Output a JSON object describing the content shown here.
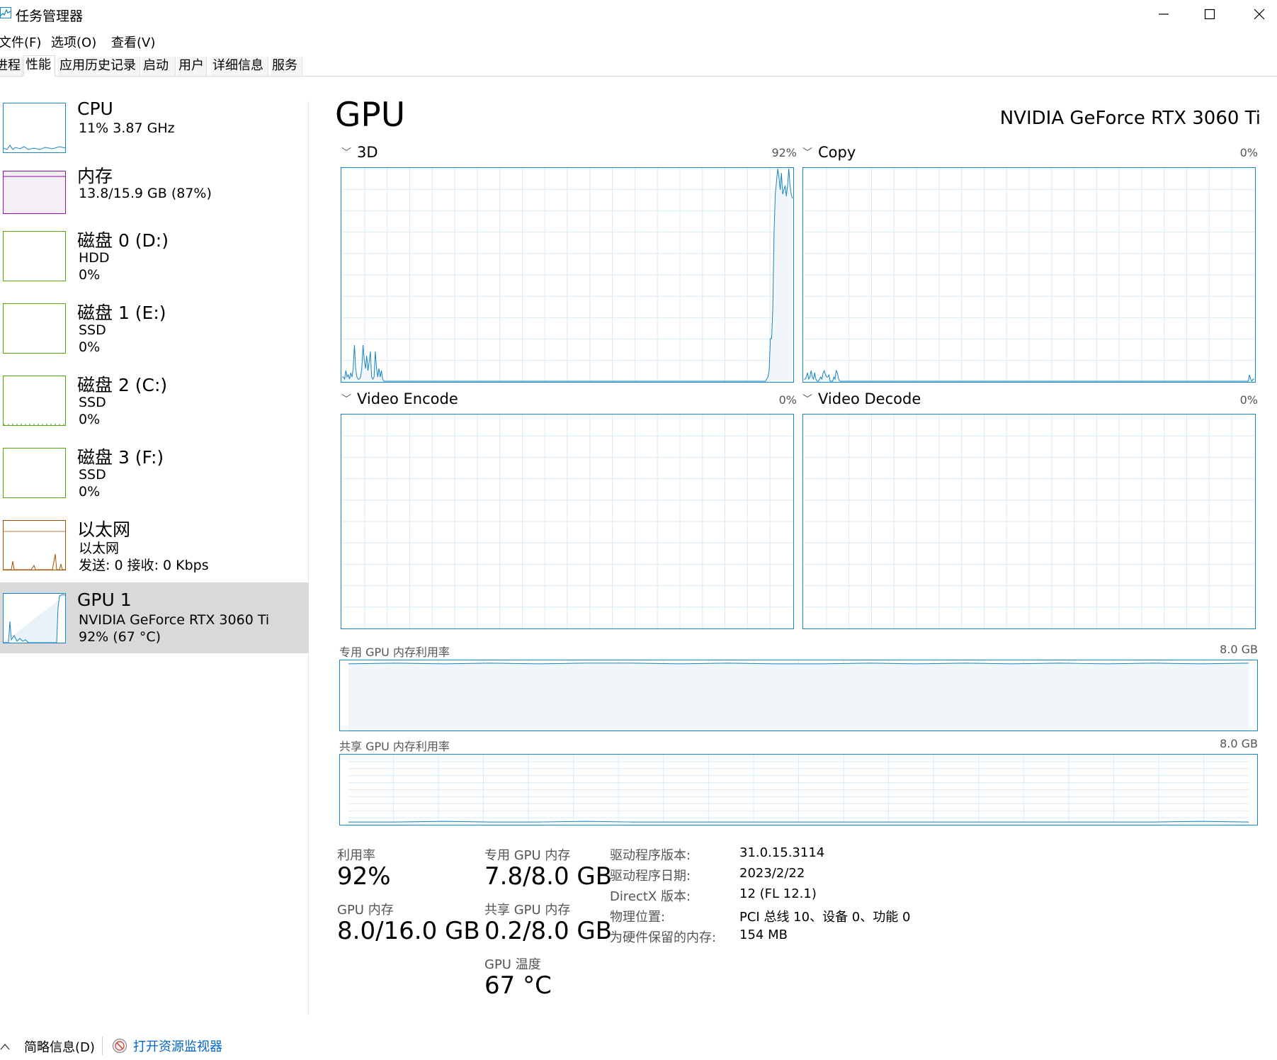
{
  "window": {
    "title": "任务管理器",
    "controls": [
      "minimize",
      "maximize",
      "close"
    ]
  },
  "menu": [
    "文件(F)",
    "选项(O)",
    "查看(V)"
  ],
  "tabs": [
    "进程",
    "性能",
    "应用历史记录",
    "启动",
    "用户",
    "详细信息",
    "服务"
  ],
  "active_tab": "性能",
  "sidebar": [
    {
      "title": "CPU",
      "line1": "11%  3.87 GHz",
      "line2": "",
      "color": "#1784c4"
    },
    {
      "title": "内存",
      "line1": "13.8/15.9 GB (87%)",
      "line2": "",
      "color": "#8b12ae"
    },
    {
      "title": "磁盘 0 (D:)",
      "line1": "HDD",
      "line2": "0%",
      "color": "#4da60c"
    },
    {
      "title": "磁盘 1 (E:)",
      "line1": "SSD",
      "line2": "0%",
      "color": "#4da60c"
    },
    {
      "title": "磁盘 2 (C:)",
      "line1": "SSD",
      "line2": "0%",
      "color": "#4da60c"
    },
    {
      "title": "磁盘 3 (F:)",
      "line1": "SSD",
      "line2": "0%",
      "color": "#4da60c"
    },
    {
      "title": "以太网",
      "line1": "以太网",
      "line2": "发送: 0 接收: 0 Kbps",
      "color": "#a74f01"
    },
    {
      "title": "GPU 1",
      "line1": "NVIDIA GeForce RTX 3060 Ti",
      "line2": "92%  (67 °C)",
      "color": "#1784c4"
    }
  ],
  "selected_index": 7,
  "gpu": {
    "heading": "GPU",
    "model": "NVIDIA GeForce RTX 3060 Ti",
    "engines": [
      {
        "name": "3D",
        "percent": "92%"
      },
      {
        "name": "Copy",
        "percent": "0%"
      },
      {
        "name": "Video Encode",
        "percent": "0%"
      },
      {
        "name": "Video Decode",
        "percent": "0%"
      }
    ],
    "dedicated_mem_graph": {
      "label": "专用 GPU 内存利用率",
      "max": "8.0 GB"
    },
    "shared_mem_graph": {
      "label": "共享 GPU 内存利用率",
      "max": "8.0 GB"
    }
  },
  "stats": {
    "utilization_label": "利用率",
    "utilization": "92%",
    "gpu_mem_label": "GPU 内存",
    "gpu_mem": "8.0/16.0 GB",
    "dedicated_label": "专用 GPU 内存",
    "dedicated": "7.8/8.0 GB",
    "shared_label": "共享 GPU 内存",
    "shared": "0.2/8.0 GB",
    "temp_label": "GPU 温度",
    "temp": "67 °C"
  },
  "info": [
    {
      "key": "驱动程序版本:",
      "value": "31.0.15.3114"
    },
    {
      "key": "驱动程序日期:",
      "value": "2023/2/22"
    },
    {
      "key": "DirectX 版本:",
      "value": "12 (FL 12.1)"
    },
    {
      "key": "物理位置:",
      "value": "PCI 总线 10、设备 0、功能 0"
    },
    {
      "key": "为硬件保留的内存:",
      "value": "154 MB"
    }
  ],
  "footer": {
    "summary": "简略信息(D)",
    "resource_monitor": "打开资源监视器"
  },
  "series": {
    "3d": [
      2,
      2,
      1,
      5,
      2,
      3,
      1,
      4,
      2,
      6,
      17,
      6,
      2,
      1,
      1,
      2,
      6,
      17,
      10,
      6,
      12,
      5,
      9,
      14,
      2,
      1,
      2,
      14,
      6,
      2,
      6,
      2,
      5,
      1,
      0,
      0,
      0,
      0,
      0,
      0,
      0,
      0,
      0,
      0,
      0,
      0,
      0,
      0,
      0,
      0,
      0,
      0,
      0,
      0,
      0,
      0,
      0,
      0,
      0,
      0,
      0,
      0,
      0,
      0,
      0,
      0,
      0,
      0,
      0,
      0,
      0,
      0,
      0,
      0,
      0,
      0,
      0,
      0,
      0,
      0,
      0,
      0,
      0,
      0,
      0,
      0,
      0,
      0,
      0,
      0,
      0,
      0,
      0,
      0,
      0,
      0,
      0,
      0,
      0,
      0,
      0,
      0,
      0,
      0,
      0,
      0,
      0,
      0,
      0,
      0,
      0,
      0,
      0,
      0,
      0,
      0,
      0,
      0,
      0,
      0,
      0,
      0,
      0,
      0,
      0,
      0,
      0,
      0,
      0,
      0,
      0,
      0,
      0,
      0,
      0,
      0,
      0,
      0,
      0,
      0,
      0,
      0,
      0,
      0,
      0,
      0,
      0,
      0,
      0,
      0,
      0,
      0,
      0,
      0,
      0,
      0,
      0,
      0,
      0,
      0,
      0,
      0,
      0,
      0,
      0,
      0,
      0,
      0,
      0,
      0,
      0,
      0,
      0,
      0,
      0,
      0,
      0,
      0,
      0,
      0,
      0,
      0,
      0,
      0,
      0,
      0,
      0,
      0,
      0,
      0,
      0,
      0,
      0,
      0,
      0,
      0,
      0,
      0,
      0,
      0,
      0,
      0,
      0,
      0,
      0,
      0,
      0,
      0,
      0,
      0,
      0,
      0,
      0,
      0,
      0,
      0,
      0,
      0,
      0,
      0,
      0,
      0,
      0,
      0,
      0,
      0,
      0,
      0,
      0,
      0,
      0,
      0,
      0,
      0,
      0,
      0,
      0,
      0,
      0,
      0,
      0,
      0,
      0,
      0,
      0,
      0,
      0,
      0,
      0,
      0,
      0,
      0,
      0,
      0,
      0,
      0,
      0,
      0,
      0,
      0,
      0,
      0,
      0,
      0,
      0,
      0,
      0,
      0,
      0,
      0,
      0,
      0,
      0,
      0,
      0,
      0,
      0,
      0,
      0,
      0,
      0,
      0,
      0,
      0,
      0,
      0,
      0,
      0,
      0,
      0,
      0,
      0,
      0,
      0,
      0,
      0,
      0,
      0,
      0,
      0,
      0,
      0,
      0,
      0,
      0,
      0,
      0,
      0,
      0,
      0,
      0,
      0,
      0,
      0,
      0,
      0,
      0,
      0,
      0,
      0,
      0,
      0,
      0,
      0,
      0,
      0,
      0,
      0,
      0,
      0,
      0,
      0,
      0,
      0,
      0,
      0,
      0,
      0,
      0,
      0,
      0,
      0,
      0,
      0,
      0,
      0,
      1,
      2,
      5,
      20,
      20,
      35,
      70,
      88,
      94,
      100,
      96,
      90,
      98,
      88,
      90,
      92,
      87,
      92,
      100,
      92,
      88,
      86
    ],
    "copy": [
      1,
      1,
      2,
      4,
      1,
      2,
      5,
      2,
      1,
      4,
      1,
      0,
      0,
      1,
      2,
      1,
      4,
      5,
      3,
      2,
      2,
      3,
      0,
      0,
      0,
      2,
      1,
      5,
      4,
      1,
      0,
      0,
      0,
      0,
      0,
      0,
      0,
      0,
      0,
      0,
      0,
      0,
      0,
      0,
      0,
      0,
      0,
      0,
      0,
      0,
      0,
      0,
      0,
      0,
      0,
      0,
      0,
      0,
      0,
      0,
      0,
      0,
      0,
      0,
      0,
      0,
      0,
      0,
      0,
      0,
      0,
      0,
      0,
      0,
      0,
      0,
      0,
      0,
      0,
      0,
      0,
      0,
      0,
      0,
      0,
      0,
      0,
      0,
      0,
      0,
      0,
      0,
      0,
      0,
      0,
      0,
      0,
      0,
      0,
      0,
      0,
      0,
      0,
      0,
      0,
      0,
      0,
      0,
      0,
      0,
      0,
      0,
      0,
      0,
      0,
      0,
      0,
      0,
      0,
      0,
      0,
      0,
      0,
      0,
      0,
      0,
      0,
      0,
      0,
      0,
      0,
      0,
      0,
      0,
      0,
      0,
      0,
      0,
      0,
      0,
      0,
      0,
      0,
      0,
      0,
      0,
      0,
      0,
      0,
      0,
      0,
      0,
      0,
      0,
      0,
      0,
      0,
      0,
      0,
      0,
      0,
      0,
      0,
      0,
      0,
      0,
      0,
      0,
      0,
      0,
      0,
      0,
      0,
      0,
      0,
      0,
      0,
      0,
      0,
      0,
      0,
      0,
      0,
      0,
      0,
      0,
      0,
      0,
      0,
      0,
      0,
      0,
      0,
      0,
      0,
      0,
      0,
      0,
      0,
      0,
      0,
      0,
      0,
      0,
      0,
      0,
      0,
      0,
      0,
      0,
      0,
      0,
      0,
      0,
      0,
      0,
      0,
      0,
      0,
      0,
      0,
      0,
      0,
      0,
      0,
      0,
      0,
      0,
      0,
      0,
      0,
      0,
      0,
      0,
      0,
      0,
      0,
      0,
      0,
      0,
      0,
      0,
      0,
      0,
      0,
      0,
      0,
      0,
      0,
      0,
      0,
      0,
      0,
      0,
      0,
      0,
      0,
      0,
      0,
      0,
      0,
      0,
      0,
      0,
      0,
      0,
      0,
      0,
      0,
      0,
      0,
      0,
      0,
      0,
      0,
      0,
      0,
      0,
      0,
      0,
      0,
      0,
      0,
      0,
      0,
      0,
      0,
      0,
      0,
      0,
      0,
      0,
      0,
      0,
      0,
      0,
      0,
      0,
      0,
      0,
      0,
      0,
      0,
      0,
      0,
      0,
      0,
      0,
      0,
      0,
      0,
      0,
      0,
      0,
      0,
      0,
      0,
      0,
      0,
      0,
      0,
      0,
      0,
      0,
      0,
      0,
      0,
      0,
      0,
      0,
      0,
      0,
      0,
      0,
      0,
      0,
      0,
      0,
      0,
      0,
      0,
      0,
      0,
      0,
      0,
      0,
      0,
      0,
      0,
      0,
      0,
      0,
      0,
      0,
      0,
      0,
      0,
      0,
      0,
      0,
      0,
      0,
      0,
      0,
      0,
      0,
      0,
      0,
      0,
      0,
      0,
      0,
      0,
      3,
      1,
      0,
      1,
      1
    ],
    "dedicated_mem": [
      96,
      97,
      96,
      97,
      96,
      97,
      97,
      96,
      97,
      96,
      96,
      97,
      96,
      97,
      96,
      97,
      96,
      97,
      96,
      97
    ],
    "shared_mem": [
      3,
      3,
      4,
      3,
      3,
      4,
      3,
      3,
      3,
      3,
      3,
      3,
      3,
      3,
      3,
      3,
      3,
      3,
      4,
      3
    ]
  }
}
